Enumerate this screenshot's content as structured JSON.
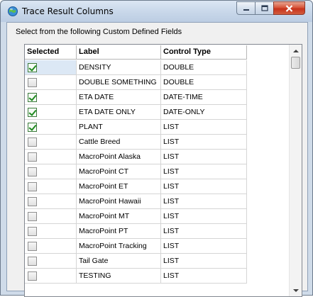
{
  "window": {
    "title": "Trace Result Columns",
    "controls": {
      "minimize": "minimize",
      "maximize": "maximize",
      "close": "close"
    }
  },
  "instruction": "Select from the following Custom Defined Fields",
  "grid": {
    "columns": [
      "Selected",
      "Label",
      "Control Type"
    ],
    "rows": [
      {
        "selected": true,
        "label": "DENSITY",
        "type": "DOUBLE"
      },
      {
        "selected": false,
        "label": "DOUBLE SOMETHING",
        "type": "DOUBLE"
      },
      {
        "selected": true,
        "label": "ETA DATE",
        "type": "DATE-TIME"
      },
      {
        "selected": true,
        "label": "ETA DATE ONLY",
        "type": "DATE-ONLY"
      },
      {
        "selected": true,
        "label": "PLANT",
        "type": "LIST"
      },
      {
        "selected": false,
        "label": "Cattle Breed",
        "type": "LIST"
      },
      {
        "selected": false,
        "label": "MacroPoint Alaska",
        "type": "LIST"
      },
      {
        "selected": false,
        "label": "MacroPoint CT",
        "type": "LIST"
      },
      {
        "selected": false,
        "label": "MacroPoint ET",
        "type": "LIST"
      },
      {
        "selected": false,
        "label": "MacroPoint Hawaii",
        "type": "LIST"
      },
      {
        "selected": false,
        "label": "MacroPoint MT",
        "type": "LIST"
      },
      {
        "selected": false,
        "label": "MacroPoint PT",
        "type": "LIST"
      },
      {
        "selected": false,
        "label": "MacroPoint Tracking",
        "type": "LIST"
      },
      {
        "selected": false,
        "label": "Tail Gate",
        "type": "LIST"
      },
      {
        "selected": false,
        "label": "TESTING",
        "type": "LIST"
      }
    ]
  },
  "icons": {
    "app": "globe-app-icon",
    "checked": "checkbox-checked-icon",
    "unchecked": "checkbox-unchecked-icon"
  },
  "colors": {
    "check": "#1f8a1f",
    "focus_cell": "#dce8f5",
    "close_button": "#c7321b"
  }
}
